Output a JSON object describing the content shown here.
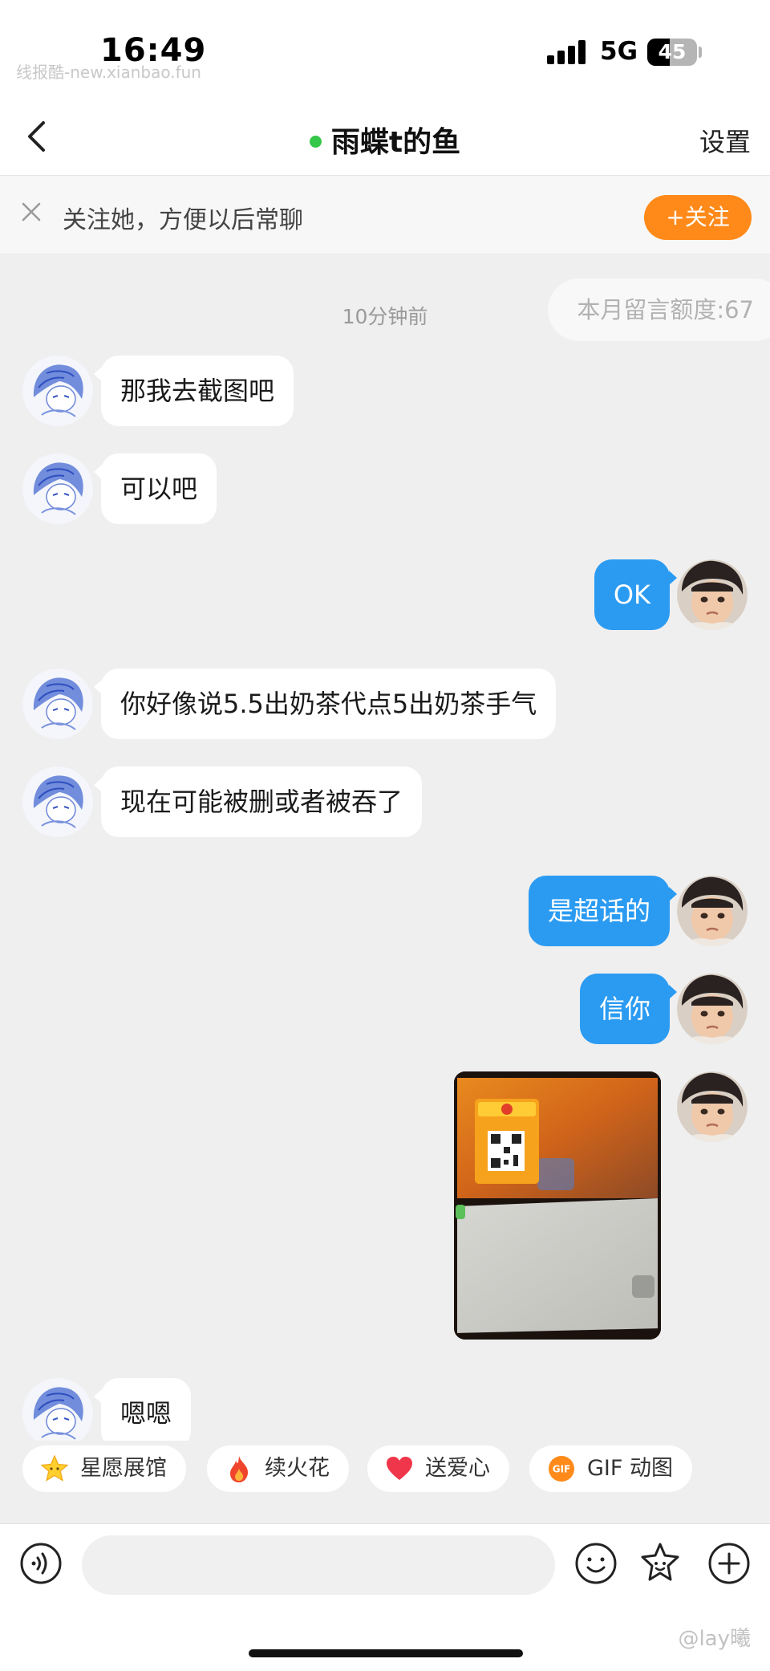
{
  "status_bar": {
    "time": "16:49",
    "network": "5G",
    "battery": "45",
    "battery_level": 0.45,
    "watermark": "线报酷-new.xianbao.fun"
  },
  "header": {
    "title": "雨蝶t的鱼",
    "online": true,
    "settings_label": "设置"
  },
  "follow_banner": {
    "text": "关注她，方便以后常聊",
    "follow_label": "+关注"
  },
  "chat": {
    "quota_text": "本月留言额度:67",
    "timestamp": "10分钟前",
    "messages": [
      {
        "from": "other",
        "text": "那我去截图吧"
      },
      {
        "from": "other",
        "text": "可以吧"
      },
      {
        "from": "me",
        "text": "OK"
      },
      {
        "from": "other",
        "text": "你好像说5.5出奶茶代点5出奶茶手气"
      },
      {
        "from": "other",
        "text": "现在可能被删或者被吞了"
      },
      {
        "from": "me",
        "text": "是超话的"
      },
      {
        "from": "me",
        "text": "信你"
      },
      {
        "from": "me",
        "type": "image"
      },
      {
        "from": "other",
        "text": "嗯嗯"
      }
    ]
  },
  "quick_actions": [
    {
      "label": "星愿展馆",
      "icon": "star-icon"
    },
    {
      "label": "续火花",
      "icon": "flame-icon"
    },
    {
      "label": "送爱心",
      "icon": "heart-icon"
    },
    {
      "label": "GIF 动图",
      "icon": "gif-icon"
    }
  ],
  "input_bar": {
    "placeholder": "",
    "watermark": "@lay曦"
  },
  "colors": {
    "outgoing_bubble": "#2b9bf2",
    "follow_button": "#ff8a1a",
    "online_dot": "#35c749",
    "chat_background": "#efefef"
  }
}
